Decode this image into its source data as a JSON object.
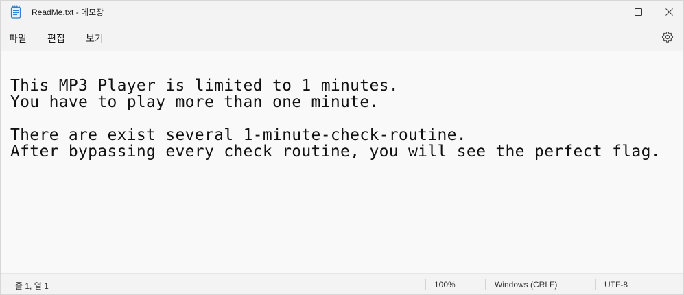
{
  "window": {
    "title": "ReadMe.txt - 메모장"
  },
  "titlebar": {
    "icons": {
      "app": "notepad-icon",
      "minimize": "minimize-icon",
      "maximize": "maximize-icon",
      "close": "close-icon"
    }
  },
  "menubar": {
    "items": [
      {
        "label": "파일"
      },
      {
        "label": "편집"
      },
      {
        "label": "보기"
      }
    ],
    "settings_icon": "gear-icon"
  },
  "editor": {
    "content": "This MP3 Player is limited to 1 minutes.\nYou have to play more than one minute.\n\nThere are exist several 1-minute-check-routine.\nAfter bypassing every check routine, you will see the perfect flag."
  },
  "statusbar": {
    "position": "줄 1, 열 1",
    "zoom": "100%",
    "line_ending": "Windows (CRLF)",
    "encoding": "UTF-8"
  },
  "colors": {
    "background": "#f9f9f9",
    "chrome": "#f3f3f3",
    "text": "#111111",
    "icon_accent": "#2f7fd6"
  }
}
